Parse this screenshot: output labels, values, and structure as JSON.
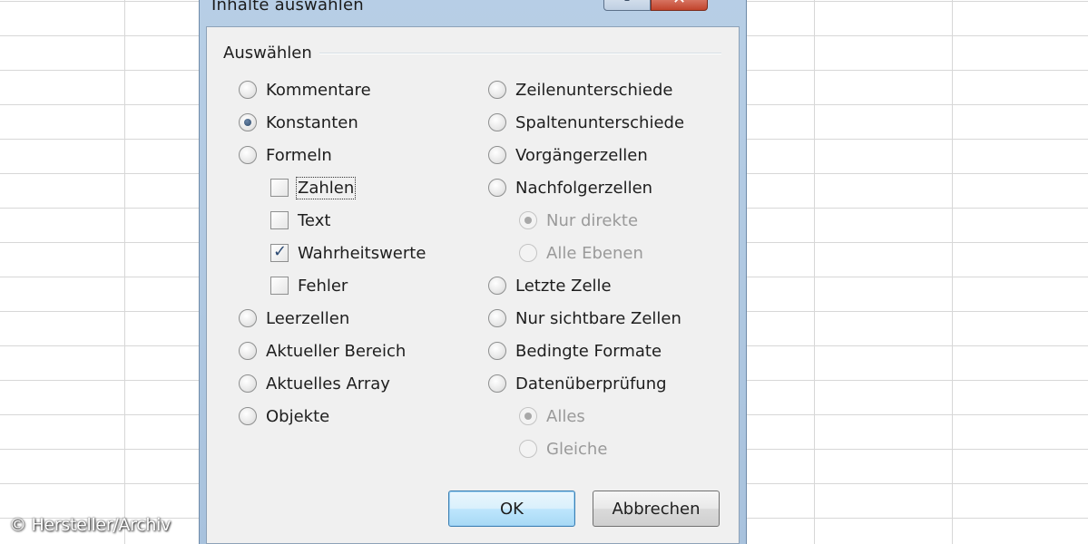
{
  "dialog": {
    "title": "Inhalte auswählen",
    "group_label": "Auswählen",
    "left_column": [
      {
        "label": "Kommentare",
        "type": "radio",
        "checked": false,
        "disabled": false
      },
      {
        "label": "Konstanten",
        "type": "radio",
        "checked": true,
        "disabled": false
      },
      {
        "label": "Formeln",
        "type": "radio",
        "checked": false,
        "disabled": false
      },
      {
        "label": "Zahlen",
        "type": "checkbox",
        "checked": false,
        "disabled": false
      },
      {
        "label": "Text",
        "type": "checkbox",
        "checked": false,
        "disabled": false
      },
      {
        "label": "Wahrheitswerte",
        "type": "checkbox",
        "checked": true,
        "disabled": false
      },
      {
        "label": "Fehler",
        "type": "checkbox",
        "checked": false,
        "disabled": false
      },
      {
        "label": "Leerzellen",
        "type": "radio",
        "checked": false,
        "disabled": false
      },
      {
        "label": "Aktueller Bereich",
        "type": "radio",
        "checked": false,
        "disabled": false
      },
      {
        "label": "Aktuelles Array",
        "type": "radio",
        "checked": false,
        "disabled": false
      },
      {
        "label": "Objekte",
        "type": "radio",
        "checked": false,
        "disabled": false
      }
    ],
    "right_column": [
      {
        "label": "Zeilenunterschiede",
        "type": "radio",
        "checked": false,
        "disabled": false
      },
      {
        "label": "Spaltenunterschiede",
        "type": "radio",
        "checked": false,
        "disabled": false
      },
      {
        "label": "Vorgängerzellen",
        "type": "radio",
        "checked": false,
        "disabled": false
      },
      {
        "label": "Nachfolgerzellen",
        "type": "radio",
        "checked": false,
        "disabled": false
      },
      {
        "label": "Nur direkte",
        "type": "radio",
        "checked": true,
        "disabled": true
      },
      {
        "label": "Alle Ebenen",
        "type": "radio",
        "checked": false,
        "disabled": true
      },
      {
        "label": "Letzte Zelle",
        "type": "radio",
        "checked": false,
        "disabled": false
      },
      {
        "label": "Nur sichtbare Zellen",
        "type": "radio",
        "checked": false,
        "disabled": false
      },
      {
        "label": "Bedingte Formate",
        "type": "radio",
        "checked": false,
        "disabled": false
      },
      {
        "label": "Datenüberprüfung",
        "type": "radio",
        "checked": false,
        "disabled": false
      },
      {
        "label": "Alles",
        "type": "radio",
        "checked": true,
        "disabled": true
      },
      {
        "label": "Gleiche",
        "type": "radio",
        "checked": false,
        "disabled": true
      }
    ],
    "ok_label": "OK",
    "cancel_label": "Abbrechen"
  },
  "watermark": "© Hersteller/Archiv",
  "colors": {
    "title_bar": "#b8cfe6",
    "close_button": "#c2442c",
    "dialog_bg": "#f0f0f0",
    "default_button_border": "#3c7fb1",
    "grid_line": "#d7d7d7"
  }
}
